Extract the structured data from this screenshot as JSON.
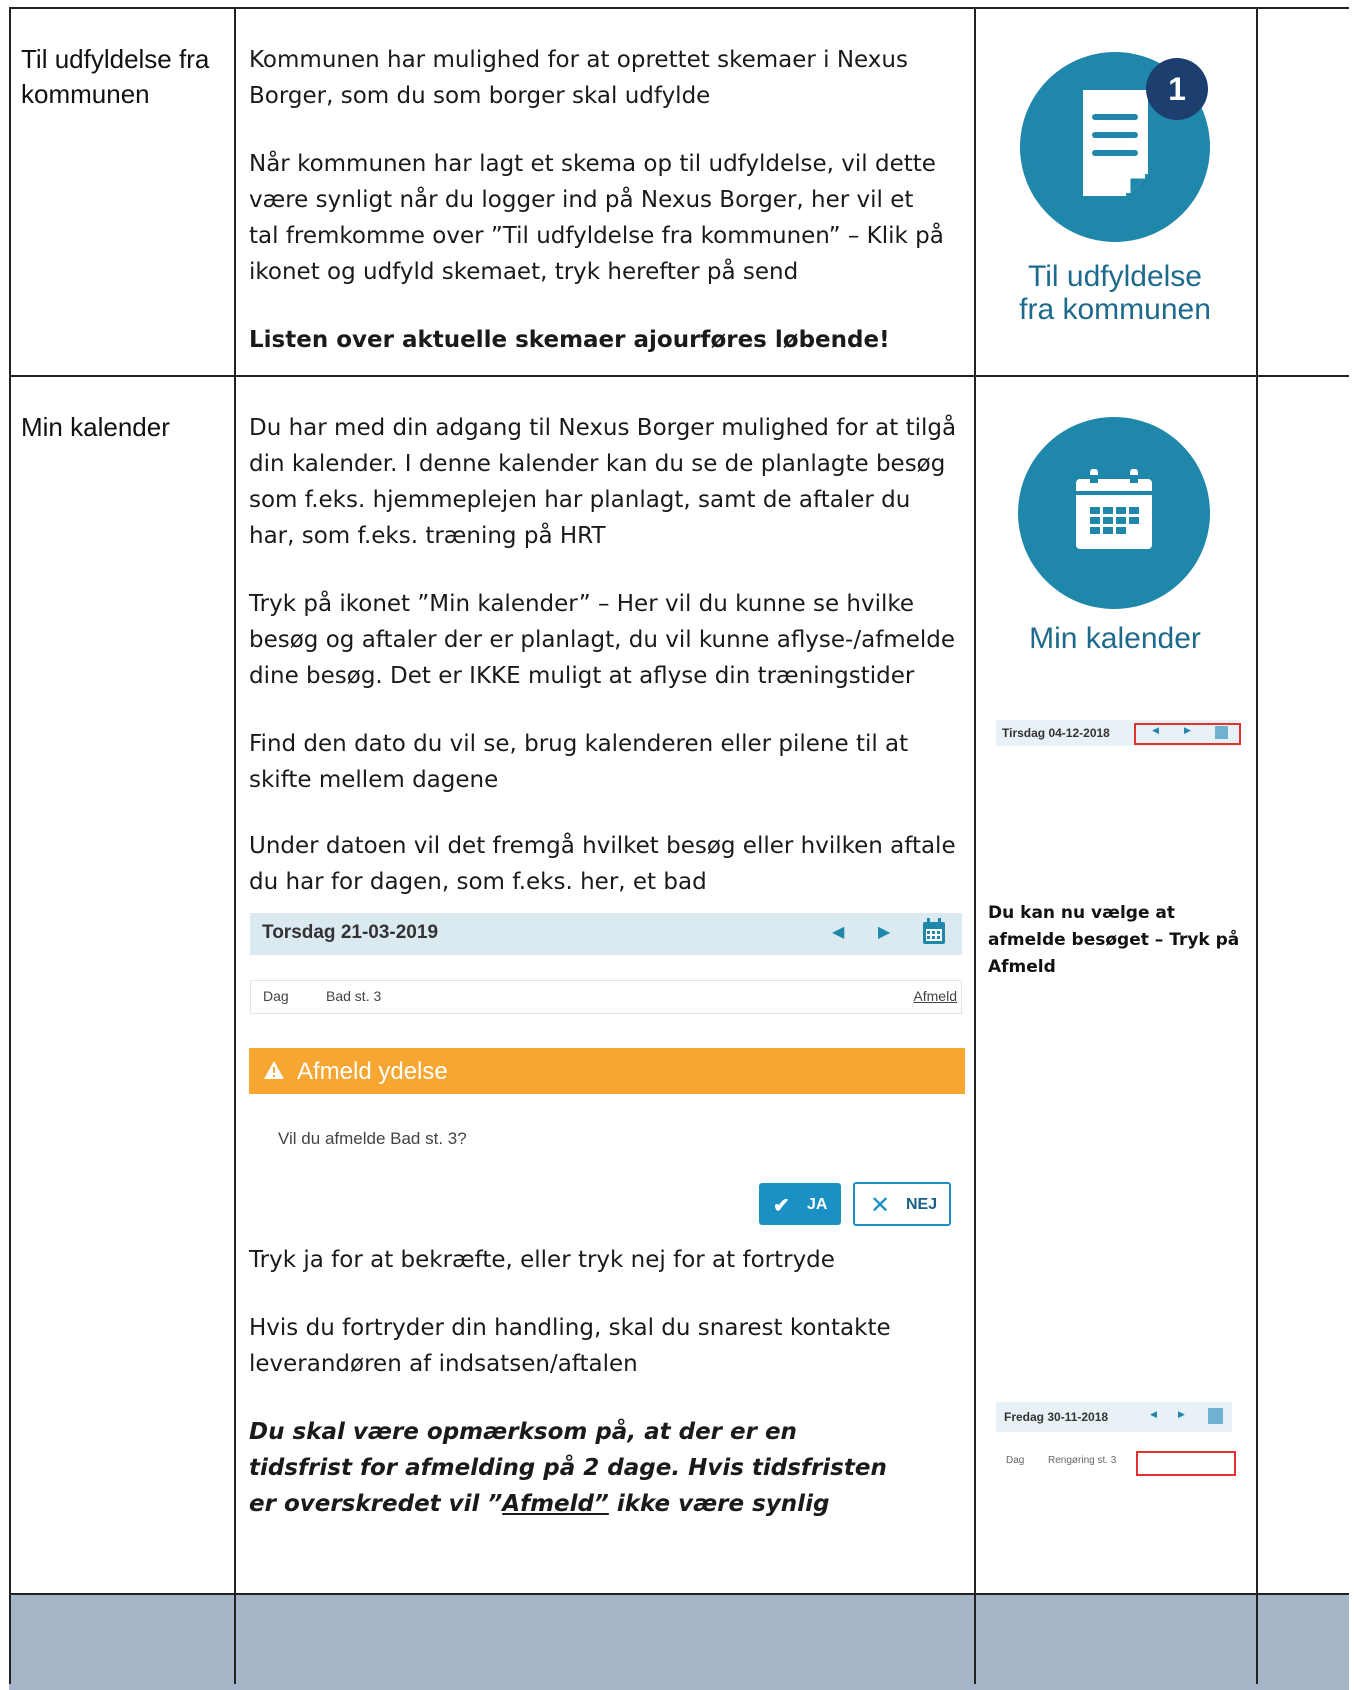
{
  "row1": {
    "label": "Til udfyldelse fra kommunen",
    "p1": "Kommunen har mulighed for at oprettet skemaer i Nexus Borger, som du som borger skal udfylde",
    "p2": "Når kommunen har lagt et skema op til udfyldelse, vil dette være synligt når du logger ind på Nexus Borger, her vil et tal fremkomme over ”Til udfyldelse fra kommunen” – Klik på ikonet og udfyld skemaet, tryk herefter på send",
    "p3": "Listen over aktuelle skemaer ajourføres løbende!",
    "icon": {
      "name": "form-document-icon",
      "badge": "1",
      "caption_line1": "Til udfyldelse",
      "caption_line2": "fra kommunen",
      "circle_color": "#1f87aa",
      "badge_color": "#1d3f70"
    }
  },
  "row2": {
    "label": "Min kalender",
    "p1": "Du har med din adgang til Nexus Borger mulighed for at tilgå din kalender. I denne kalender kan du se de planlagte besøg som f.eks. hjemmeplejen har planlagt, samt de aftaler du har, som f.eks. træning på HRT",
    "p2": "Tryk på ikonet ”Min kalender” – Her vil du kunne se hvilke besøg og aftaler der er planlagt, du vil kunne aflyse-/afmelde dine besøg. Det er IKKE muligt at aflyse din træningstider",
    "p3": "Find den dato du vil se, brug kalenderen eller pilene til at skifte mellem dagene",
    "p4": "Under datoen vil det fremgå hvilket besøg eller hvilken aftale du har for dagen, som f.eks. her, et bad",
    "p5": "Tryk ja for at bekræfte, eller tryk nej for at fortryde",
    "p6": "Hvis du fortryder din handling, skal du snarest kontakte leverandøren af indsatsen/aftalen",
    "p7a": "Du skal være opmærksom på, at der er en tidsfrist for afmelding på 2 dage. Hvis tidsfristen er overskredet vil ”",
    "p7b": "Afmeld”",
    "p7c": " ikke være synlig",
    "icon": {
      "name": "calendar-icon",
      "caption": "Min kalender"
    },
    "mini_nav_1": {
      "date": "Tirsdag 04-12-2018"
    },
    "side_note": "Du kan nu vælge at afmelde besøget – Tryk på Afmeld",
    "mini_nav_2": {
      "date": "Fredag 30-11-2018",
      "row_label": "Dag",
      "row_item": "Rengøring st. 3"
    },
    "calendar_widget": {
      "date": "Torsdag 21-03-2019",
      "row_label": "Dag",
      "row_item": "Bad st. 3",
      "action": "Afmeld"
    },
    "dialog": {
      "title": "Afmeld ydelse",
      "question": "Vil du afmelde Bad st. 3?",
      "yes": "JA",
      "no": "NEJ"
    }
  },
  "colors": {
    "accent": "#1f87aa",
    "warning": "#f7a632",
    "nav_bg": "#dbe9f0",
    "button_blue": "#1a90c5",
    "highlight_red": "#e53030",
    "footer_band": "#a6b6c8"
  }
}
